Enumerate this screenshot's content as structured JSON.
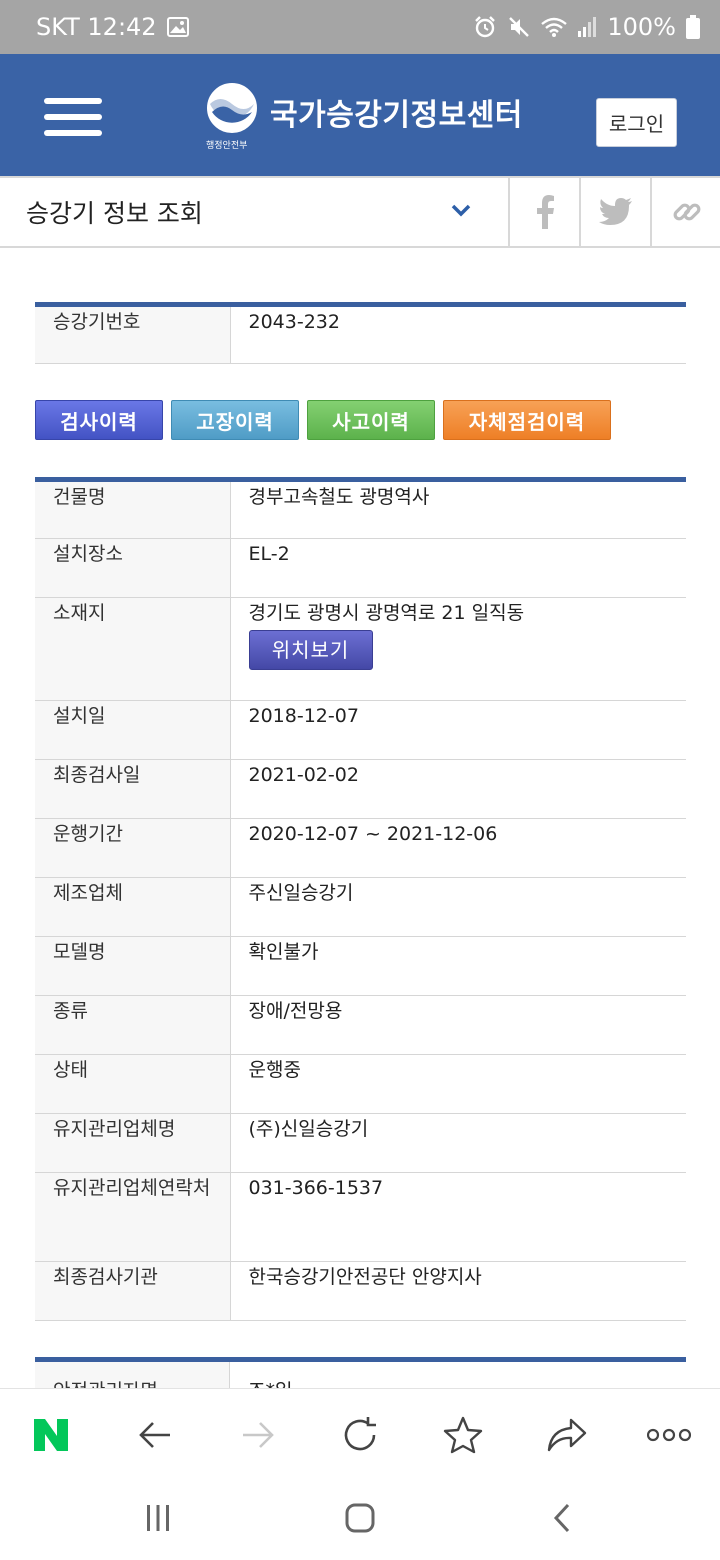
{
  "status_bar": {
    "carrier_time": "SKT 12:42",
    "battery": "100%"
  },
  "header": {
    "site_title": "국가승강기정보센터",
    "ministry_label": "행정안전부",
    "login_label": "로그인"
  },
  "subnav": {
    "title": "승강기 정보 조회"
  },
  "elevator_number": {
    "label": "승강기번호",
    "value": "2043-232"
  },
  "history_tabs": [
    {
      "label": "검사이력",
      "color": "#4f5fd4"
    },
    {
      "label": "고장이력",
      "color": "#5ca7cf"
    },
    {
      "label": "사고이력",
      "color": "#6bbf5a"
    },
    {
      "label": "자체점검이력",
      "color": "#f08a32"
    }
  ],
  "details": {
    "building": {
      "label": "건물명",
      "value": "경부고속철도 광명역사"
    },
    "install_place": {
      "label": "설치장소",
      "value": "EL-2"
    },
    "address": {
      "label": "소재지",
      "value": "경기도 광명시 광명역로 21 일직동",
      "map_button": "위치보기"
    },
    "install_date": {
      "label": "설치일",
      "value": "2018-12-07"
    },
    "last_inspection_date": {
      "label": "최종검사일",
      "value": "2021-02-02"
    },
    "operation_period": {
      "label": "운행기간",
      "value": "2020-12-07 ~ 2021-12-06"
    },
    "manufacturer": {
      "label": "제조업체",
      "value": "주신일승강기"
    },
    "model": {
      "label": "모델명",
      "value": "확인불가"
    },
    "type": {
      "label": "종류",
      "value": "장애/전망용"
    },
    "status": {
      "label": "상태",
      "value": "운행중"
    },
    "maintenance_company": {
      "label": "유지관리업체명",
      "value": "(주)신일승강기"
    },
    "maintenance_contact": {
      "label": "유지관리업체연락처",
      "value": "031-366-1537"
    },
    "inspection_agency": {
      "label": "최종검사기관",
      "value": "한국승강기안전공단 안양지사"
    }
  },
  "next_section": {
    "label": "안전관리자명",
    "value": "조*일"
  },
  "colors": {
    "header_bg": "#3a63a6",
    "table_accent": "#3a5f9f",
    "naver_green": "#03c75a"
  },
  "icons": {
    "browser_bar": [
      "naver-home-icon",
      "back-arrow-icon",
      "forward-arrow-icon",
      "refresh-icon",
      "star-icon",
      "share-icon",
      "more-icon"
    ],
    "system_nav": [
      "recent-apps-icon",
      "home-icon",
      "back-icon"
    ]
  }
}
